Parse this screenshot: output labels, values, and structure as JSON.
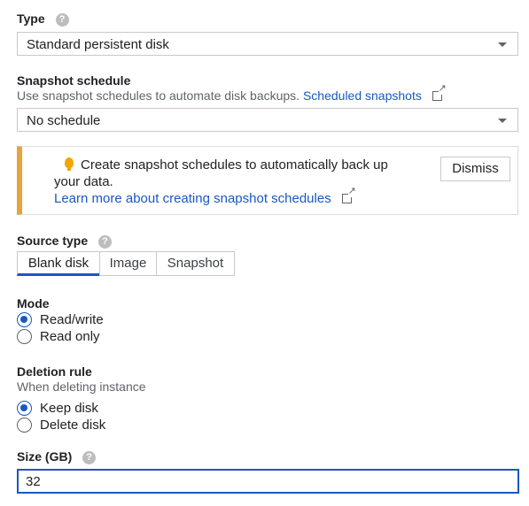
{
  "type": {
    "label": "Type",
    "value": "Standard persistent disk"
  },
  "snapshot_schedule": {
    "label": "Snapshot schedule",
    "description": "Use snapshot schedules to automate disk backups.",
    "link": "Scheduled snapshots",
    "value": "No schedule"
  },
  "banner": {
    "line1": "Create snapshot schedules to automatically back up",
    "line2": "your data.",
    "link": "Learn more about creating snapshot schedules",
    "dismiss": "Dismiss",
    "accent_color": "#e8a33d"
  },
  "source_type": {
    "label": "Source type",
    "options": [
      "Blank disk",
      "Image",
      "Snapshot"
    ],
    "selected": "Blank disk"
  },
  "mode": {
    "label": "Mode",
    "options": [
      "Read/write",
      "Read only"
    ],
    "selected": "Read/write"
  },
  "deletion_rule": {
    "label": "Deletion rule",
    "description": "When deleting instance",
    "options": [
      "Keep disk",
      "Delete disk"
    ],
    "selected": "Keep disk"
  },
  "size": {
    "label": "Size (GB)",
    "value": "32"
  },
  "icons": {
    "help": "help-icon",
    "external": "external-link-icon",
    "bulb": "lightbulb-icon",
    "dropdown": "chevron-down-icon"
  },
  "colors": {
    "accent": "#1a57c4",
    "warning": "#e8a33d"
  }
}
